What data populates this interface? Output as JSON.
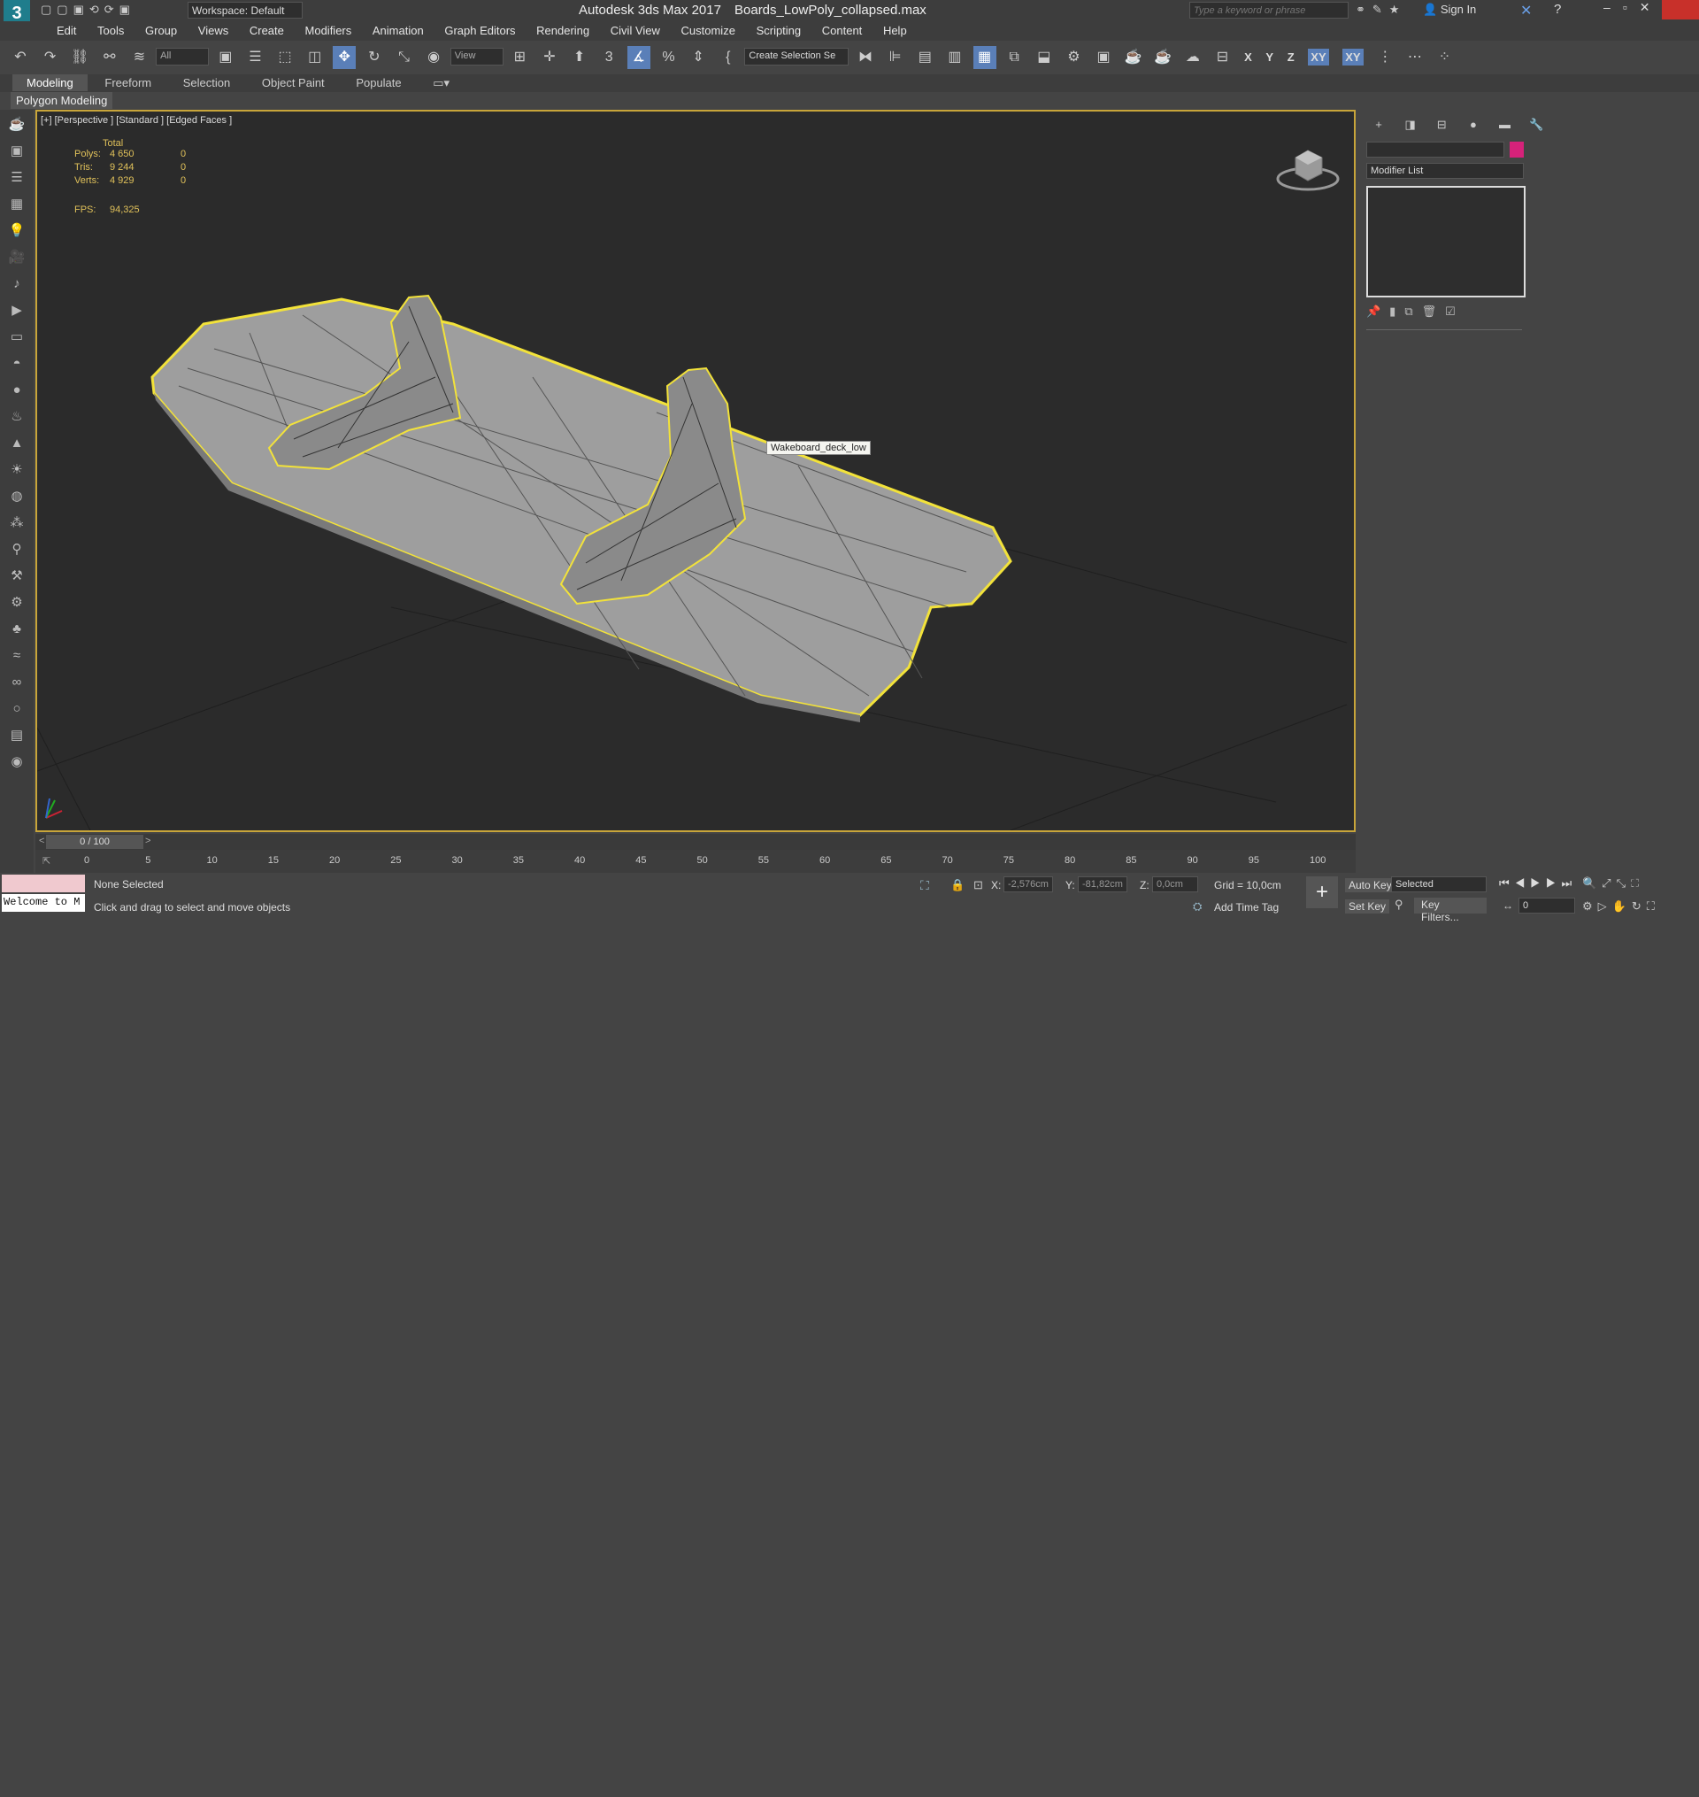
{
  "titlebar": {
    "app_title": "Autodesk 3ds Max 2017",
    "file_name": "Boards_LowPoly_collapsed.max",
    "workspace_label": "Workspace: Default",
    "search_placeholder": "Type a keyword or phrase",
    "sign_in": "Sign In",
    "logo_text": "3"
  },
  "menu": {
    "items": [
      "Edit",
      "Tools",
      "Group",
      "Views",
      "Create",
      "Modifiers",
      "Animation",
      "Graph Editors",
      "Rendering",
      "Civil View",
      "Customize",
      "Scripting",
      "Content",
      "Help"
    ]
  },
  "toolbar": {
    "filter_select": "All",
    "ref_coord_select": "View",
    "selection_set_select": "Create Selection Se",
    "axis_x": "X",
    "axis_y": "Y",
    "axis_z": "Z",
    "axis_xy": "XY",
    "axis_xy2": "XY"
  },
  "ribbon": {
    "tabs": [
      "Modeling",
      "Freeform",
      "Selection",
      "Object Paint",
      "Populate"
    ],
    "active_tab": "Modeling",
    "sub_label": "Polygon Modeling"
  },
  "viewport": {
    "label": "[+] [Perspective ] [Standard ] [Edged Faces ]",
    "stats": {
      "header": "Total",
      "polys_label": "Polys:",
      "polys_value": "4 650",
      "polys_sel": "0",
      "tris_label": "Tris:",
      "tris_value": "9 244",
      "tris_sel": "0",
      "verts_label": "Verts:",
      "verts_value": "4 929",
      "verts_sel": "0",
      "fps_label": "FPS:",
      "fps_value": "94,325"
    },
    "tooltip": "Wakeboard_deck_low",
    "colors": {
      "background": "#2b2b2b",
      "selection": "#f2e23a",
      "mesh": "#a9a9a9"
    }
  },
  "command_panel": {
    "modifier_list_label": "Modifier List",
    "color_swatch": "#d6227a"
  },
  "timeline": {
    "frame_display": "0 / 100",
    "ticks": [
      "0",
      "5",
      "10",
      "15",
      "20",
      "25",
      "30",
      "35",
      "40",
      "45",
      "50",
      "55",
      "60",
      "65",
      "70",
      "75",
      "80",
      "85",
      "90",
      "95",
      "100"
    ]
  },
  "status": {
    "script_listener": "Welcome to M",
    "selection_status": "None Selected",
    "prompt": "Click and drag to select and move objects",
    "x_label": "X:",
    "x_value": "-2,576cm",
    "y_label": "Y:",
    "y_value": "-81,82cm",
    "z_label": "Z:",
    "z_value": "0,0cm",
    "grid": "Grid = 10,0cm",
    "add_time_tag": "Add Time Tag",
    "auto_key": "Auto Key",
    "set_key": "Set Key",
    "selected_select": "Selected",
    "key_filters": "Key Filters...",
    "frame_value": "0"
  }
}
